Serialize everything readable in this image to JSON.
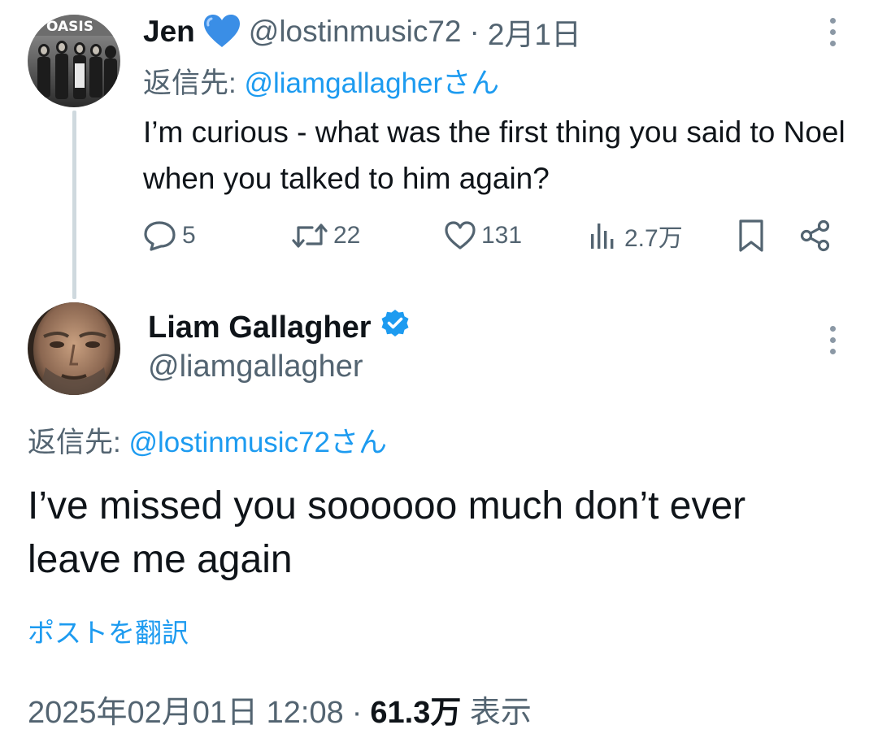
{
  "parent_tweet": {
    "author_name": "Jen",
    "author_emoji": "blue-heart",
    "handle": "@lostinmusic72",
    "separator": "·",
    "date": "2月1日",
    "reply_prefix": "返信先: ",
    "reply_to": "@liamgallagherさん",
    "text": "I’m curious - what was the first thing you said to Noel when you talked to him again?",
    "stats": {
      "replies": "5",
      "reposts": "22",
      "likes": "131",
      "views": "2.7万"
    },
    "avatar_text": "OASIS"
  },
  "main_tweet": {
    "author_name": "Liam Gallagher",
    "verified": true,
    "handle": "@liamgallagher",
    "reply_prefix": "返信先: ",
    "reply_to": "@lostinmusic72さん",
    "text": "I’ve missed you soooooo much don’t ever leave me again",
    "translate_label": "ポストを翻訳",
    "timestamp": "2025年02月01日 12:08",
    "separator": "·",
    "views_count": "61.3万",
    "views_label": "表示"
  },
  "colors": {
    "link": "#1d9bf0",
    "muted": "#536471",
    "text": "#0f1419",
    "thread_line": "#cfd9de"
  }
}
